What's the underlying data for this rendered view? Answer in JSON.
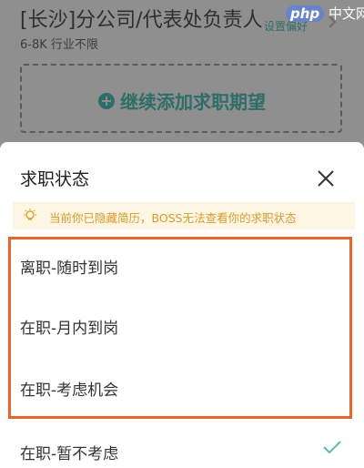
{
  "background": {
    "job_title": "[长沙]分公司/代表处负责人",
    "job_sub": "6-8K 行业不限",
    "set_preference": "设置偏好",
    "add_button": "继续添加求职期望",
    "watermark_php": "php",
    "watermark_text": "中文网"
  },
  "sheet": {
    "title": "求职状态",
    "notice": "当前你已隐藏简历，BOSS无法查看你的求职状态",
    "options": [
      {
        "label": "离职-随时到岗"
      },
      {
        "label": "在职-月内到岗"
      },
      {
        "label": "在职-考虑机会"
      },
      {
        "label": "在职-暂不考虑",
        "selected": true
      }
    ]
  },
  "colors": {
    "accent": "#2f6d6a",
    "check": "#5fb8b0",
    "highlight_border": "#e8642c",
    "notice_bg": "#fdf6e5",
    "notice_text": "#d89a2a"
  }
}
